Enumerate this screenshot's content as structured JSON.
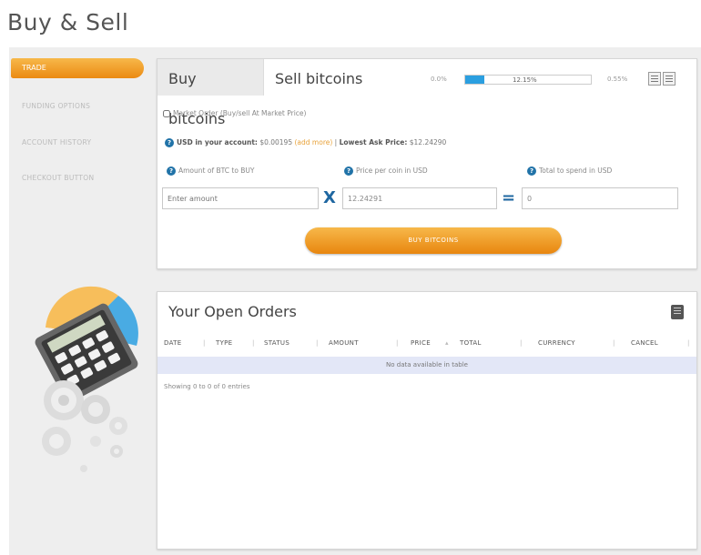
{
  "page": {
    "title": "Buy & Sell"
  },
  "sidebar": {
    "items": [
      {
        "label": "TRADE",
        "active": true
      },
      {
        "label": "FUNDING OPTIONS",
        "active": false
      },
      {
        "label": "ACCOUNT HISTORY",
        "active": false
      },
      {
        "label": "CHECKOUT BUTTON",
        "active": false
      }
    ]
  },
  "trade": {
    "tabs": [
      {
        "label": "Buy bitcoins",
        "active": true
      },
      {
        "label": "Sell bitcoins",
        "active": false
      }
    ],
    "range_low": "0.0%",
    "range_value": "12.15%",
    "range_fill_fraction": 0.15,
    "range_high": "0.55%",
    "market_order_label": "Market Order (Buy/sell At Market Price)",
    "market_order_checked": false,
    "usd_label": "USD in your account:",
    "usd_value": "$0.00195",
    "add_more_label": "(add more)",
    "separator": "|",
    "lowest_ask_label": "Lowest Ask Price:",
    "lowest_ask_value": "$12.24290",
    "amount_label": "Amount of BTC to BUY",
    "amount_placeholder": "Enter amount",
    "price_label": "Price per coin in USD",
    "price_value": "12.24291",
    "total_label": "Total to spend in USD",
    "total_value": "0",
    "multiply_symbol": "X",
    "equals_symbol": "=",
    "buy_button_label": "BUY BITCOINS"
  },
  "orders": {
    "title": "Your Open Orders",
    "columns": [
      "DATE",
      "TYPE",
      "STATUS",
      "AMOUNT",
      "PRICE",
      "TOTAL",
      "CURRENCY",
      "CANCEL"
    ],
    "empty_message": "No data available in table",
    "showing_text": "Showing 0 to 0 of 0 entries"
  },
  "colors": {
    "accent_orange": "#eb8a12",
    "link_blue": "#1f67a1",
    "bar_blue": "#2b9fe0",
    "empty_row": "#e3e7f7"
  },
  "icons": [
    "info-icon",
    "export-icon",
    "list-view-icon",
    "grid-view-icon",
    "calculator-icon"
  ]
}
